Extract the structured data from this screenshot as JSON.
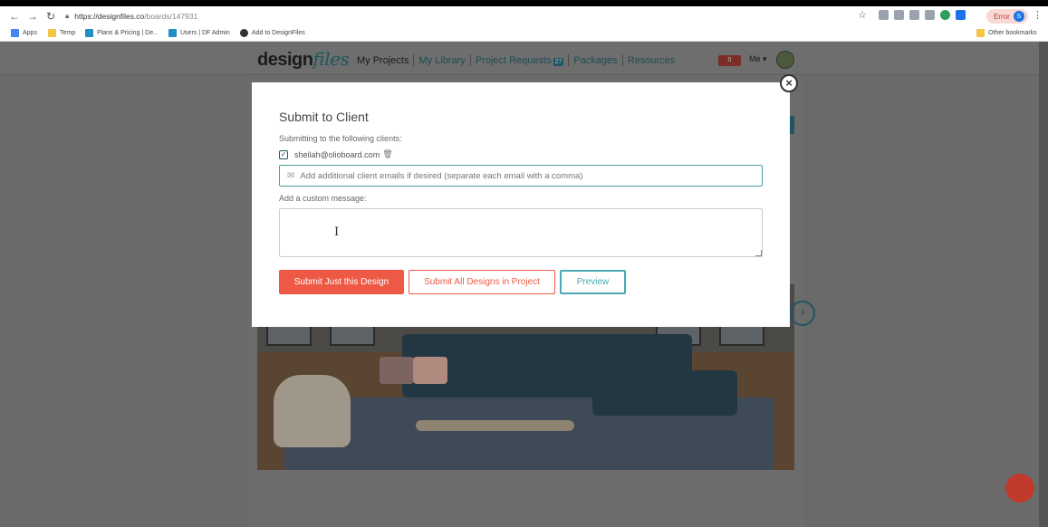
{
  "browser": {
    "url_domain": "https://designfiles.co",
    "url_path": "/boards/147931",
    "error_label": "Error",
    "profile_initial": "S",
    "bookmarks": [
      {
        "label": "Apps"
      },
      {
        "label": "Temp"
      },
      {
        "label": "Plans & Pricing | De..."
      },
      {
        "label": "Users | DF Admin"
      },
      {
        "label": "Add to DesignFiles"
      }
    ],
    "other_bookmarks": "Other bookmarks"
  },
  "site": {
    "logo_main": "design",
    "logo_italic": "files",
    "nav": {
      "my_projects": "My Projects",
      "my_library": "My Library",
      "project_requests": "Project Requests",
      "project_requests_badge": "27",
      "packages": "Packages",
      "resources": "Resources"
    },
    "notifications_count": "0",
    "user_menu": "Me ▾"
  },
  "modal": {
    "title": "Submit to Client",
    "subtitle": "Submitting to the following clients:",
    "client_email": "sheilah@olioboard.com",
    "email_placeholder": "Add additional client emails if desired (separate each email with a comma)",
    "message_label": "Add a custom message:",
    "buttons": {
      "submit_design": "Submit Just this Design",
      "submit_all": "Submit All Designs in Project",
      "preview": "Preview"
    }
  },
  "colors": {
    "accent_coral": "#ee5946",
    "accent_teal": "#4aa9b2",
    "brand_dark_teal": "#1f5661"
  },
  "icons": [
    "back-icon",
    "forward-icon",
    "reload-icon",
    "lock-icon",
    "star-icon",
    "checkbox-icon",
    "trash-icon",
    "envelope-icon",
    "close-icon",
    "next-arrow-icon",
    "text-cursor-icon"
  ]
}
